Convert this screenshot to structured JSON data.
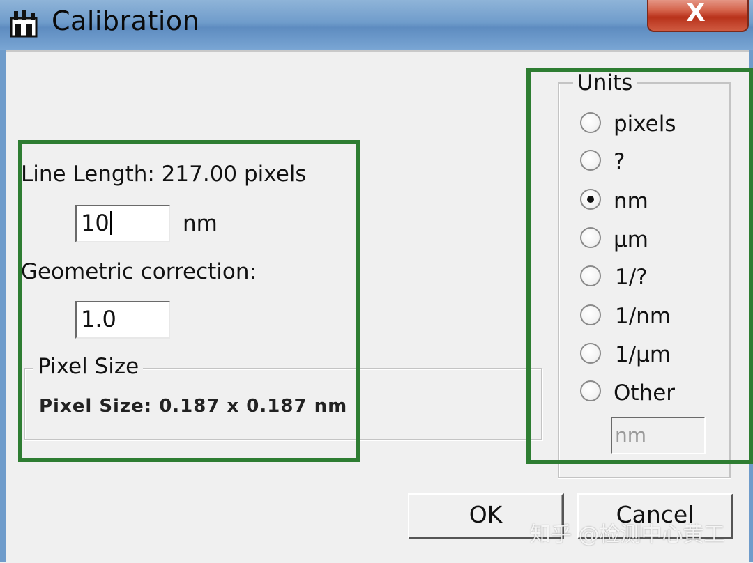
{
  "window": {
    "title": "Calibration",
    "close_glyph": "X"
  },
  "line_length": {
    "label": "Line Length: 217.00 pixels",
    "value": "10",
    "unit": "nm"
  },
  "geometric_correction": {
    "label": "Geometric correction:",
    "value": "1.0"
  },
  "pixel_size": {
    "group_label": "Pixel Size",
    "text": "Pixel Size: 0.187 x 0.187 nm"
  },
  "units": {
    "group_label": "Units",
    "options": [
      {
        "label": "pixels",
        "selected": false
      },
      {
        "label": "?",
        "selected": false
      },
      {
        "label": "nm",
        "selected": true
      },
      {
        "label": "µm",
        "selected": false
      },
      {
        "label": "1/?",
        "selected": false
      },
      {
        "label": "1/nm",
        "selected": false
      },
      {
        "label": "1/µm",
        "selected": false
      },
      {
        "label": "Other",
        "selected": false
      }
    ],
    "other_placeholder": "nm"
  },
  "buttons": {
    "ok": "OK",
    "cancel": "Cancel"
  },
  "watermark": "知乎 @检测中心黄工",
  "colors": {
    "highlight": "#2e7d32",
    "titlebar": "#6f9ccb",
    "close_button": "#c8452c"
  },
  "icons": {
    "app": "calibration-app-icon",
    "close": "close-icon"
  }
}
